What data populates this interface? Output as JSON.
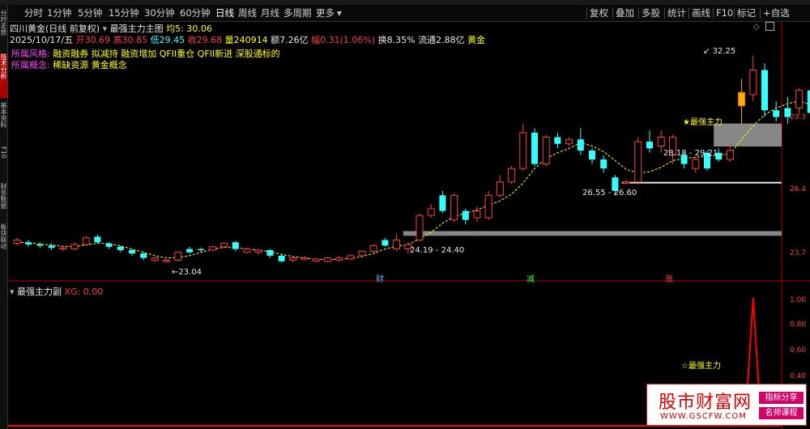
{
  "toolbar": {
    "periods": [
      "分时",
      "1分钟",
      "5分钟",
      "15分钟",
      "30分钟",
      "60分钟",
      "日线",
      "周线",
      "月线",
      "多周期",
      "更多"
    ],
    "active_period": "日线",
    "right_buttons": [
      "复权",
      "叠加",
      "多股",
      "统计",
      "画线",
      "F10",
      "标记",
      "+自选"
    ]
  },
  "left_tabs": [
    "分时走势",
    "技术分析",
    "基本资料",
    "F10",
    "财务数据",
    "板块联动"
  ],
  "info": {
    "stock_name": "四川黄金(日线 前复权)",
    "indicator": "最强主力主图",
    "ma_label": "均5: 30.06",
    "date": "2025/10/17/五",
    "open": "开30.69",
    "high": "高30.85",
    "low": "低29.45",
    "close": "收29.68",
    "volume": "量240914",
    "amount": "额7.26亿",
    "change": "幅0.31(1.06%)",
    "turnover": "换8.35%",
    "float_cap": "流通2.88亿",
    "sector": "黄金",
    "style_label": "所属风格:",
    "style_value": "融资融券 拟减持 融资增加 QFII重仓 QFII新进 深股通标的",
    "concept_label": "所属概念:",
    "concept_value": "稀缺资源 黄金概念"
  },
  "right_axis": {
    "main": [
      "29.3",
      "26.4",
      "23.7"
    ],
    "sub": [
      "1.00",
      "0.80",
      "0.60",
      "0.40"
    ]
  },
  "annotations": {
    "high_label": "32.25",
    "low_label": "23.04",
    "zone1": "24.19 - 24.40",
    "zone2": "26.55 - 26.60",
    "zone3": "28.18 - 29.21",
    "star_main": "★最强主力",
    "star_sub": "☆最强主力"
  },
  "events": [
    {
      "label": "财",
      "color": "#66aaff"
    },
    {
      "label": "减",
      "color": "#33ff33"
    },
    {
      "label": "涨",
      "color": "#ff4444"
    }
  ],
  "sub_header": {
    "name": "最强主力副",
    "xg": "XG: 0.00"
  },
  "watermark": {
    "title": "股市财富网",
    "url": "WWW.GSCFW.COM",
    "badge1": "指标分享",
    "badge2": "名师课程"
  },
  "colors": {
    "up": "#ff3b3b",
    "down": "#33ffff",
    "ma": "#ffff00",
    "zone": "#b4b4b4",
    "signal": "#ff0000"
  },
  "chart_data": {
    "type": "candlestick",
    "ylim": [
      22.5,
      33.5
    ],
    "candles": [
      [
        23.85,
        24.0,
        23.75,
        24.1
      ],
      [
        23.9,
        23.8,
        23.7,
        24.0
      ],
      [
        23.8,
        23.75,
        23.65,
        23.9
      ],
      [
        23.75,
        23.65,
        23.55,
        23.85
      ],
      [
        23.65,
        23.6,
        23.5,
        23.75
      ],
      [
        23.6,
        23.8,
        23.55,
        23.9
      ],
      [
        23.8,
        24.1,
        23.75,
        24.2
      ],
      [
        24.15,
        23.9,
        23.85,
        24.25
      ],
      [
        23.85,
        23.7,
        23.6,
        23.9
      ],
      [
        23.7,
        23.55,
        23.45,
        23.75
      ],
      [
        23.55,
        23.4,
        23.3,
        23.6
      ],
      [
        23.4,
        23.2,
        23.1,
        23.45
      ],
      [
        23.2,
        23.1,
        23.0,
        23.25
      ],
      [
        23.1,
        23.04,
        23.0,
        23.15
      ],
      [
        23.1,
        23.45,
        23.05,
        23.5
      ],
      [
        23.45,
        23.6,
        23.4,
        23.7
      ],
      [
        23.6,
        23.55,
        23.45,
        23.65
      ],
      [
        23.55,
        23.7,
        23.5,
        23.75
      ],
      [
        23.7,
        23.85,
        23.65,
        23.9
      ],
      [
        23.9,
        23.6,
        23.5,
        23.95
      ],
      [
        23.6,
        23.45,
        23.4,
        23.65
      ],
      [
        23.45,
        23.55,
        23.35,
        23.6
      ],
      [
        23.55,
        23.3,
        23.2,
        23.6
      ],
      [
        23.3,
        23.05,
        23.0,
        23.35
      ],
      [
        23.1,
        23.2,
        23.0,
        23.25
      ],
      [
        23.2,
        23.15,
        23.1,
        23.3
      ],
      [
        23.15,
        23.05,
        23.0,
        23.2
      ],
      [
        23.05,
        23.2,
        23.0,
        23.25
      ],
      [
        23.2,
        23.1,
        23.05,
        23.3
      ],
      [
        23.15,
        23.3,
        23.1,
        23.35
      ],
      [
        23.3,
        23.5,
        23.25,
        23.55
      ],
      [
        23.5,
        23.75,
        23.45,
        23.8
      ],
      [
        23.75,
        24.0,
        23.7,
        24.1
      ],
      [
        24.0,
        23.6,
        23.5,
        24.3
      ],
      [
        23.6,
        23.8,
        23.4,
        23.9
      ],
      [
        24.0,
        25.1,
        23.95,
        25.2
      ],
      [
        25.1,
        25.4,
        25.0,
        25.6
      ],
      [
        25.3,
        26.0,
        25.2,
        26.2
      ],
      [
        26.0,
        24.9,
        24.8,
        26.1
      ],
      [
        24.9,
        25.3,
        24.7,
        25.4
      ],
      [
        25.3,
        25.0,
        24.8,
        25.5
      ],
      [
        25.0,
        26.0,
        24.9,
        26.2
      ],
      [
        26.0,
        26.6,
        25.9,
        26.9
      ],
      [
        26.6,
        27.2,
        26.5,
        27.3
      ],
      [
        27.2,
        28.8,
        27.1,
        29.2
      ],
      [
        28.8,
        27.4,
        27.3,
        29.0
      ],
      [
        27.4,
        28.6,
        27.3,
        28.7
      ],
      [
        28.6,
        28.3,
        28.1,
        28.8
      ],
      [
        28.3,
        28.5,
        28.2,
        28.6
      ],
      [
        28.5,
        28.0,
        27.8,
        29.0
      ],
      [
        28.0,
        27.6,
        27.4,
        28.1
      ],
      [
        27.6,
        27.2,
        27.0,
        27.8
      ],
      [
        26.8,
        26.2,
        26.0,
        26.9
      ],
      [
        26.6,
        26.55,
        26.5,
        26.7
      ],
      [
        26.6,
        28.4,
        26.5,
        28.6
      ],
      [
        28.4,
        28.1,
        27.9,
        28.9
      ],
      [
        28.2,
        28.6,
        27.9,
        28.9
      ],
      [
        28.6,
        27.8,
        27.4,
        28.7
      ],
      [
        27.8,
        27.4,
        27.2,
        27.9
      ],
      [
        27.6,
        27.2,
        27.0,
        27.7
      ],
      [
        27.2,
        27.9,
        27.1,
        28.0
      ],
      [
        27.9,
        27.6,
        27.5,
        28.1
      ],
      [
        27.6,
        28.0,
        27.5,
        28.3
      ],
      [
        30.0,
        30.6,
        29.2,
        31.2
      ],
      [
        30.5,
        31.6,
        30.2,
        32.25
      ],
      [
        31.6,
        29.8,
        29.5,
        31.9
      ],
      [
        29.8,
        29.5,
        29.3,
        30.2
      ],
      [
        29.5,
        29.9,
        29.2,
        30.4
      ],
      [
        29.9,
        30.7,
        29.6,
        30.8
      ],
      [
        30.69,
        29.68,
        29.45,
        30.85
      ]
    ],
    "candle_colors": [
      "up",
      "down",
      "down",
      "down",
      "up",
      "up",
      "up",
      "down",
      "down",
      "down",
      "down",
      "down",
      "up",
      "up",
      "up",
      "down",
      "down",
      "up",
      "up",
      "down",
      "up",
      "up",
      "down",
      "down",
      "up",
      "up",
      "up",
      "up",
      "up",
      "up",
      "up",
      "up",
      "down",
      "up",
      "up",
      "up",
      "up",
      "down",
      "up",
      "down",
      "up",
      "up",
      "up",
      "up",
      "up",
      "down",
      "up",
      "down",
      "up",
      "down",
      "down",
      "down",
      "down",
      "up",
      "up",
      "down",
      "up",
      "up",
      "down",
      "up",
      "down",
      "down",
      "up",
      "gold",
      "up",
      "down",
      "down",
      "down",
      "up",
      "down"
    ],
    "ma": [
      23.9,
      23.88,
      23.82,
      23.78,
      23.72,
      23.7,
      23.78,
      23.86,
      23.84,
      23.74,
      23.6,
      23.45,
      23.3,
      23.2,
      23.22,
      23.3,
      23.45,
      23.58,
      23.68,
      23.66,
      23.6,
      23.55,
      23.48,
      23.36,
      23.26,
      23.2,
      23.14,
      23.12,
      23.14,
      23.18,
      23.26,
      23.4,
      23.6,
      23.72,
      23.8,
      24.05,
      24.35,
      24.75,
      25.05,
      25.2,
      25.35,
      25.55,
      25.75,
      26.05,
      26.55,
      27.2,
      27.65,
      27.9,
      28.1,
      28.35,
      28.2,
      27.95,
      27.55,
      27.15,
      27.0,
      27.05,
      27.25,
      27.55,
      27.65,
      27.7,
      27.75,
      27.8,
      27.85,
      28.5,
      29.1,
      29.6,
      29.9,
      30.1,
      30.2,
      30.06
    ],
    "zones": [
      {
        "price_low": 24.19,
        "price_high": 24.4,
        "start_index": 34
      },
      {
        "price_low": 26.55,
        "price_high": 26.6,
        "start_index": 53
      },
      {
        "price_low": 28.18,
        "price_high": 29.21,
        "start_index": 61
      }
    ],
    "signal": {
      "index": 64,
      "value": 1.0
    },
    "sub_ylim": [
      0,
      1.05
    ]
  }
}
